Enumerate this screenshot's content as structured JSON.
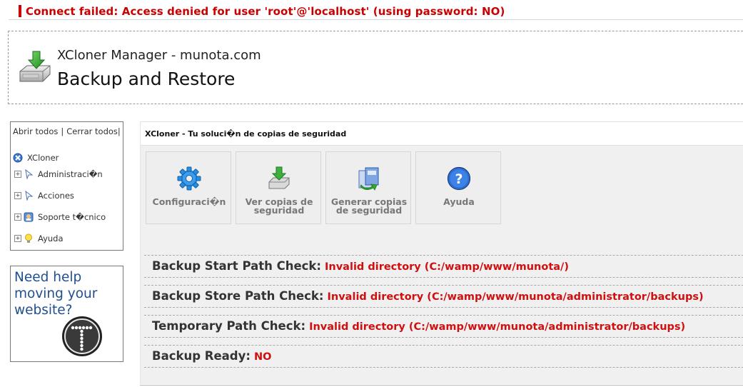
{
  "error": {
    "message": "Connect failed: Access denied for user 'root'@'localhost' (using password: NO)"
  },
  "header": {
    "logo_icon": "download-drive-icon",
    "subtitle": "XCloner Manager - munota.com",
    "title": "Backup and Restore"
  },
  "tree": {
    "open_all": "Abrir todos",
    "separator": "|",
    "close_all": "Cerrar todos",
    "trailing": "|",
    "root": {
      "label": "XCloner",
      "icon": "xcloner-icon"
    },
    "items": [
      {
        "label": "Administraci�n",
        "icon": "pointer-icon"
      },
      {
        "label": "Acciones",
        "icon": "pointer-icon"
      },
      {
        "label": "Soporte t�cnico",
        "icon": "support-icon"
      },
      {
        "label": "Ayuda",
        "icon": "lightbulb-icon"
      }
    ]
  },
  "help_box": {
    "text": "Need help moving your website?",
    "badge_icon": "t-logo-icon"
  },
  "main": {
    "heading": "XCloner - Tu soluci�n de copias de seguridad",
    "tiles": [
      {
        "line1": "Configuraci�n",
        "line2": "",
        "icon": "gear-icon"
      },
      {
        "line1": "Ver copias de",
        "line2": "seguridad",
        "icon": "download-icon"
      },
      {
        "line1": "Generar copias",
        "line2": "de seguridad",
        "icon": "generate-backup-icon"
      },
      {
        "line1": "Ayuda",
        "line2": "",
        "icon": "question-icon"
      }
    ],
    "checks": [
      {
        "label": "Backup Start Path Check:",
        "value": "Invalid directory (C:/wamp/www/munota/)"
      },
      {
        "label": "Backup Store Path Check:",
        "value": "Invalid directory (C:/wamp/www/munota/administrator/backups)"
      },
      {
        "label": "Temporary Path Check:",
        "value": "Invalid directory (C:/wamp/www/munota/administrator/backups)"
      },
      {
        "label": "Backup Ready:",
        "value": "NO"
      }
    ]
  },
  "colors": {
    "error": "#cc0000",
    "link_blue": "#1f4f8f",
    "panel_bg": "#f0f0f0"
  }
}
